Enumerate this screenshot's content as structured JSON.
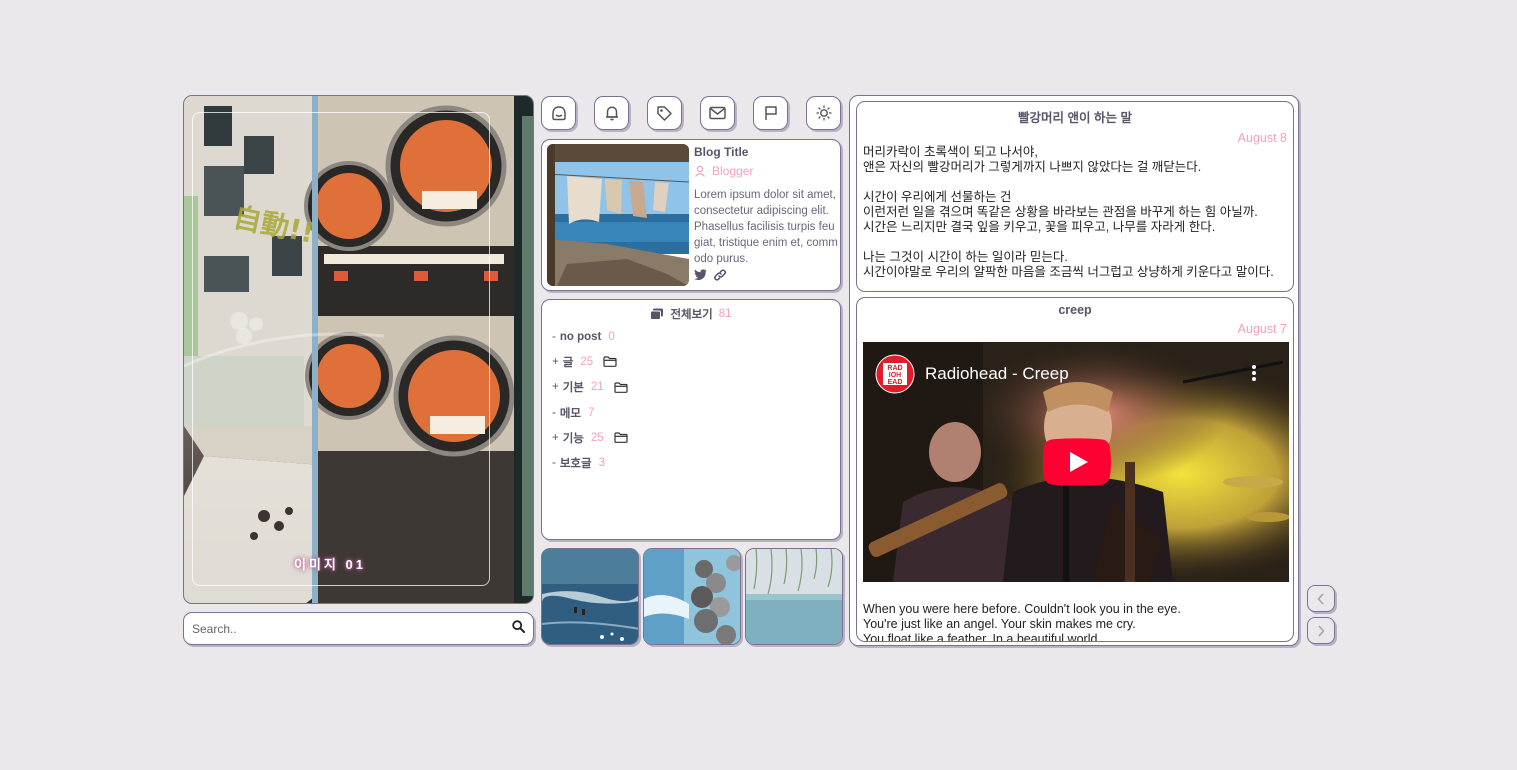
{
  "hero": {
    "caption": "이미지 01",
    "sign_text": "自動!!"
  },
  "search": {
    "placeholder": "Search.."
  },
  "toolbar": {
    "icons": [
      "home-icon",
      "bell-icon",
      "tag-icon",
      "mail-icon",
      "flag-icon",
      "sun-icon"
    ]
  },
  "profile": {
    "title": "Blog Title",
    "blogger": "Blogger",
    "description": "Lorem ipsum dolor sit amet, consectetur adipiscing elit. Phasellus facilisis turpis feugiat, tristique enim et, commodo purus."
  },
  "category": {
    "all_label": "전체보기",
    "all_count": "81",
    "items": [
      {
        "prefix": "-",
        "name": "no post",
        "count": "0",
        "folder": false
      },
      {
        "prefix": "+",
        "name": "글",
        "count": "25",
        "folder": true
      },
      {
        "prefix": "+",
        "name": "기본",
        "count": "21",
        "folder": true
      },
      {
        "prefix": "-",
        "name": "메모",
        "count": "7",
        "folder": false
      },
      {
        "prefix": "+",
        "name": "기능",
        "count": "25",
        "folder": true
      },
      {
        "prefix": "-",
        "name": "보호글",
        "count": "3",
        "folder": false
      }
    ]
  },
  "posts": [
    {
      "title": "빨강머리 앤이 하는 말",
      "date": "August 8",
      "paragraphs": [
        [
          "머리카락이 초록색이 되고 나서야,",
          "앤은 자신의 빨강머리가 그렇게까지 나쁘지 않았다는 걸 깨닫는다."
        ],
        [
          "시간이 우리에게 선물하는 건",
          "이런저런 일을 겪으며 똑같은 상황을 바라보는 관점을 바꾸게 하는 힘 아닐까.",
          "시간은 느리지만 결국 잎을 키우고, 꽃을 피우고, 나무를 자라게 한다."
        ],
        [
          "나는 그것이 시간이 하는 일이라 믿는다.",
          "시간이야말로 우리의 얄팍한 마음을 조금씩 너그럽고 상냥하게 키운다고 말이다."
        ]
      ]
    },
    {
      "title": "creep",
      "date": "August 7",
      "video_title": "Radiohead - Creep",
      "channel_logo": "RAD IOHE AD",
      "lines": [
        "When you were here before. Couldn't look you in the eye.",
        "You're just like an angel. Your skin makes me cry.",
        "You float like a feather. In a beautiful world."
      ]
    }
  ],
  "colors": {
    "accent_pink": "#f2a0c0",
    "border": "#7a7290",
    "text_muted": "#5a5468",
    "background": "#ebe8ec",
    "youtube_red": "#ff0033"
  }
}
